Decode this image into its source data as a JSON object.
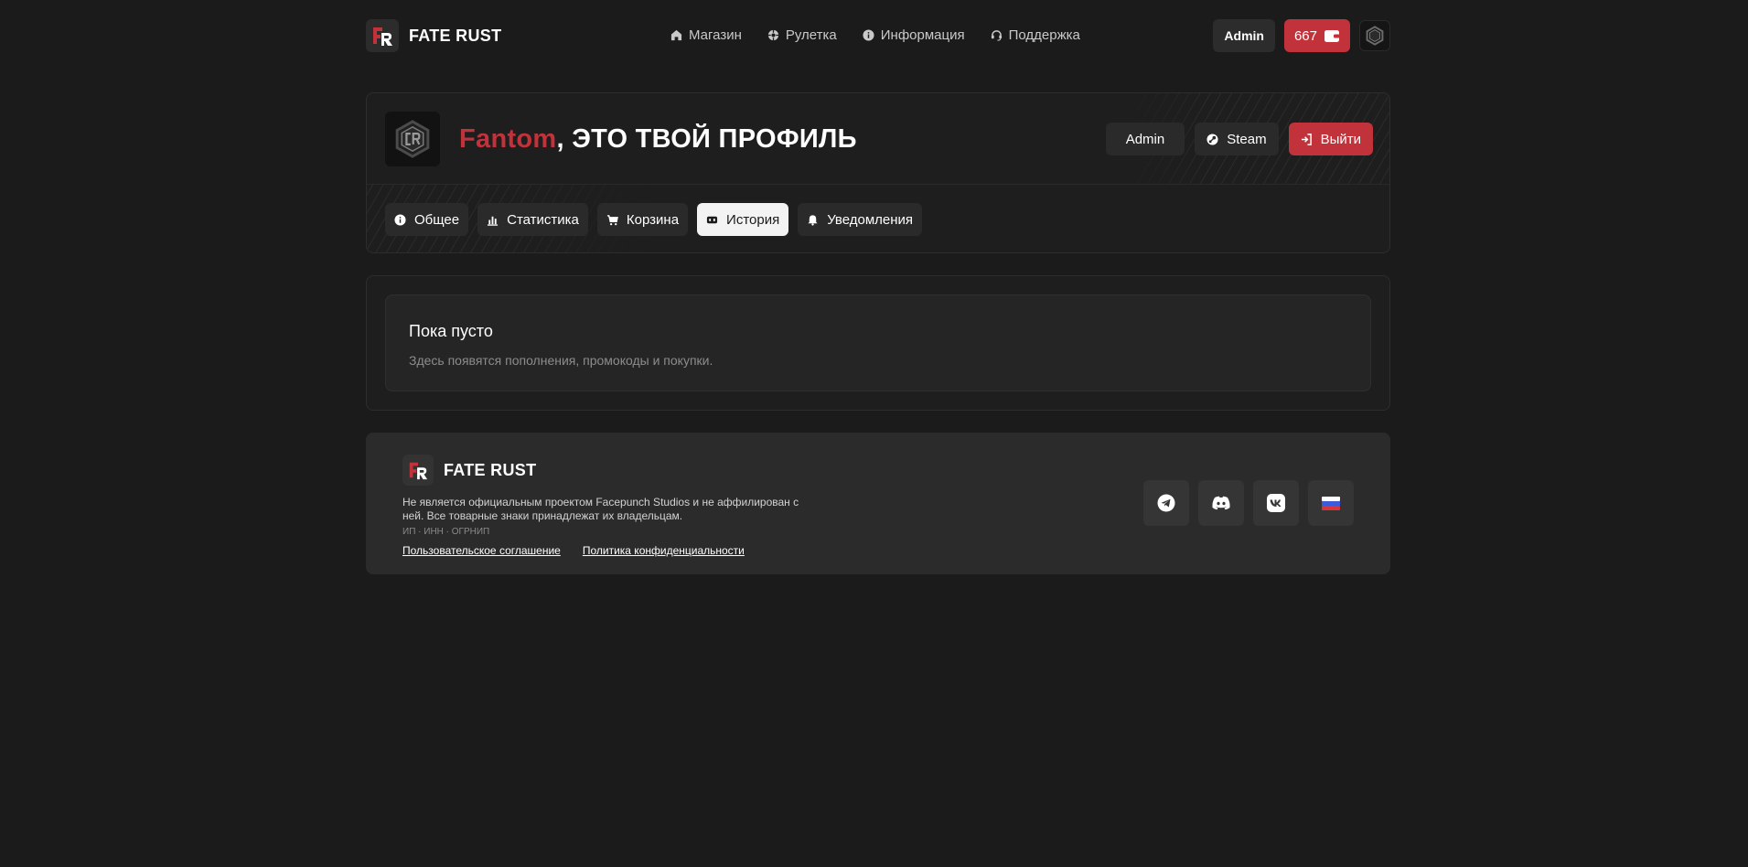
{
  "header": {
    "brand": "FATE RUST",
    "nav": [
      {
        "label": "Магазин",
        "icon": "home-icon"
      },
      {
        "label": "Рулетка",
        "icon": "roulette-icon"
      },
      {
        "label": "Информация",
        "icon": "info-icon"
      },
      {
        "label": "Поддержка",
        "icon": "support-icon"
      }
    ],
    "user_label": "Admin",
    "balance": "667"
  },
  "profile": {
    "username": "Fantom",
    "greeting_suffix": ", ЭТО ТВОЙ ПРОФИЛЬ",
    "role_label": "Admin",
    "steam_label": "Steam",
    "logout_label": "Выйти",
    "tabs": [
      {
        "label": "Общее",
        "icon": "info-icon",
        "active": false
      },
      {
        "label": "Статистика",
        "icon": "chart-icon",
        "active": false
      },
      {
        "label": "Корзина",
        "icon": "cart-icon",
        "active": false
      },
      {
        "label": "История",
        "icon": "history-icon",
        "active": true
      },
      {
        "label": "Уведомления",
        "icon": "bell-icon",
        "active": false
      }
    ]
  },
  "history": {
    "empty_title": "Пока пусто",
    "empty_subtitle": "Здесь появятся пополнения, промокоды и покупки."
  },
  "footer": {
    "brand": "FATE RUST",
    "disclaimer": "Не является официальным проектом Facepunch Studios и не аффилирован с ней. Все товарные знаки принадлежат их владельцам.",
    "legal": "ИП · ИНН · ОГРНИП",
    "links": [
      "Пользовательское соглашение",
      "Политика конфиденциальности"
    ],
    "socials": [
      "telegram-icon",
      "discord-icon",
      "vk-icon",
      "russia-flag-icon"
    ]
  },
  "colors": {
    "accent": "#c1323a",
    "background": "#1b1b1b",
    "panel": "#2b2b2b"
  }
}
